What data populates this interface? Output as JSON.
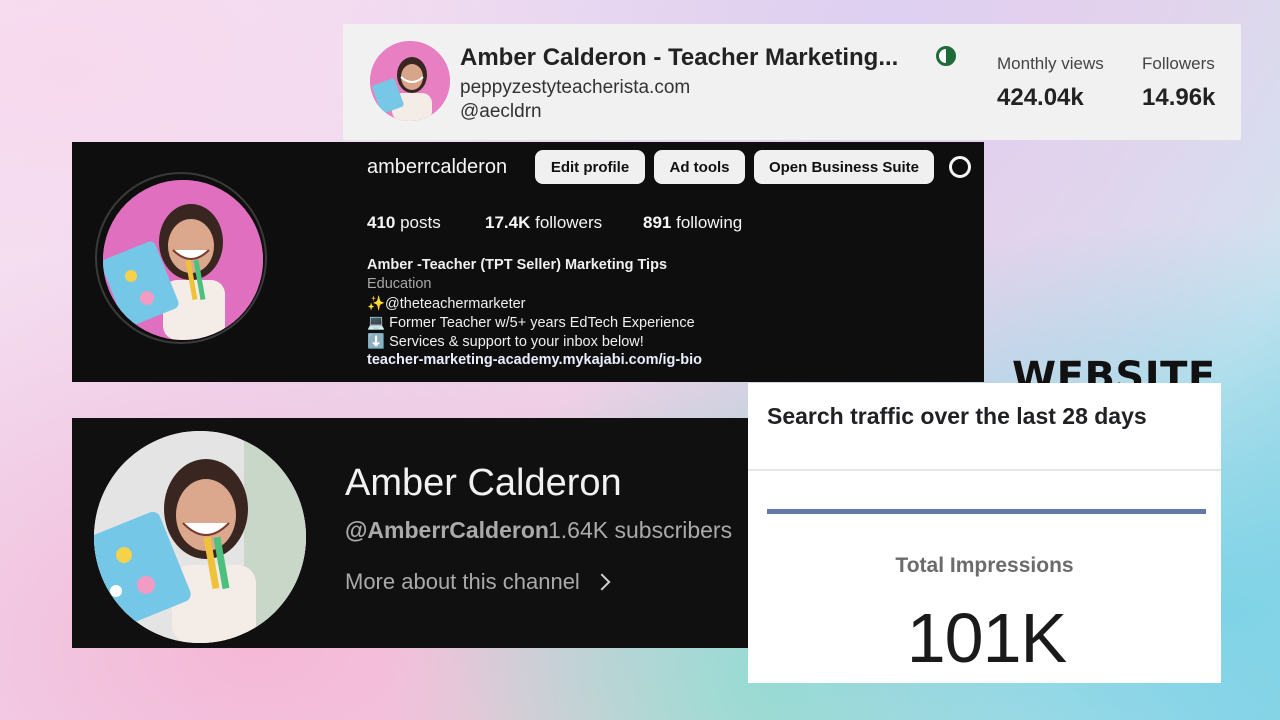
{
  "stats_card": {
    "name": "Amber Calderon - Teacher Marketing...",
    "website": "peppyzestyteacherista.com",
    "handle": "@aecldrn",
    "monthly_views_label": "Monthly views",
    "monthly_views_value": "424.04k",
    "followers_label": "Followers",
    "followers_value": "14.96k",
    "theme_icon": "contrast-icon",
    "theme_icon_color": "#1f6b3b"
  },
  "instagram": {
    "username": "amberrcalderon",
    "buttons": {
      "edit_profile": "Edit profile",
      "ad_tools": "Ad tools",
      "business_suite": "Open Business Suite"
    },
    "settings_icon": "gear-icon",
    "counts": {
      "posts_value": "410",
      "posts_label": " posts",
      "followers_value": "17.4K",
      "followers_label": " followers",
      "following_value": "891",
      "following_label": " following"
    },
    "bio": {
      "name": "Amber -Teacher (TPT Seller) Marketing Tips",
      "category": "Education",
      "line1": "✨@theteachermarketer",
      "line2": "💻 Former Teacher w/5+ years EdTech Experience",
      "line3": "⬇️ Services & support to your inbox below!",
      "link": "teacher-marketing-academy.mykajabi.com/ig-bio"
    }
  },
  "youtube": {
    "channel_name": "Amber Calderon",
    "handle": "@AmberrCalderon",
    "subscribers": "1.64K subscribers",
    "more_link": "More about this channel"
  },
  "website": {
    "heading": "WEBSITE",
    "panel_title": "Search traffic over the last 28 days",
    "metric_label": "Total Impressions",
    "metric_value": "101K",
    "metric_color": "#6278a9"
  }
}
